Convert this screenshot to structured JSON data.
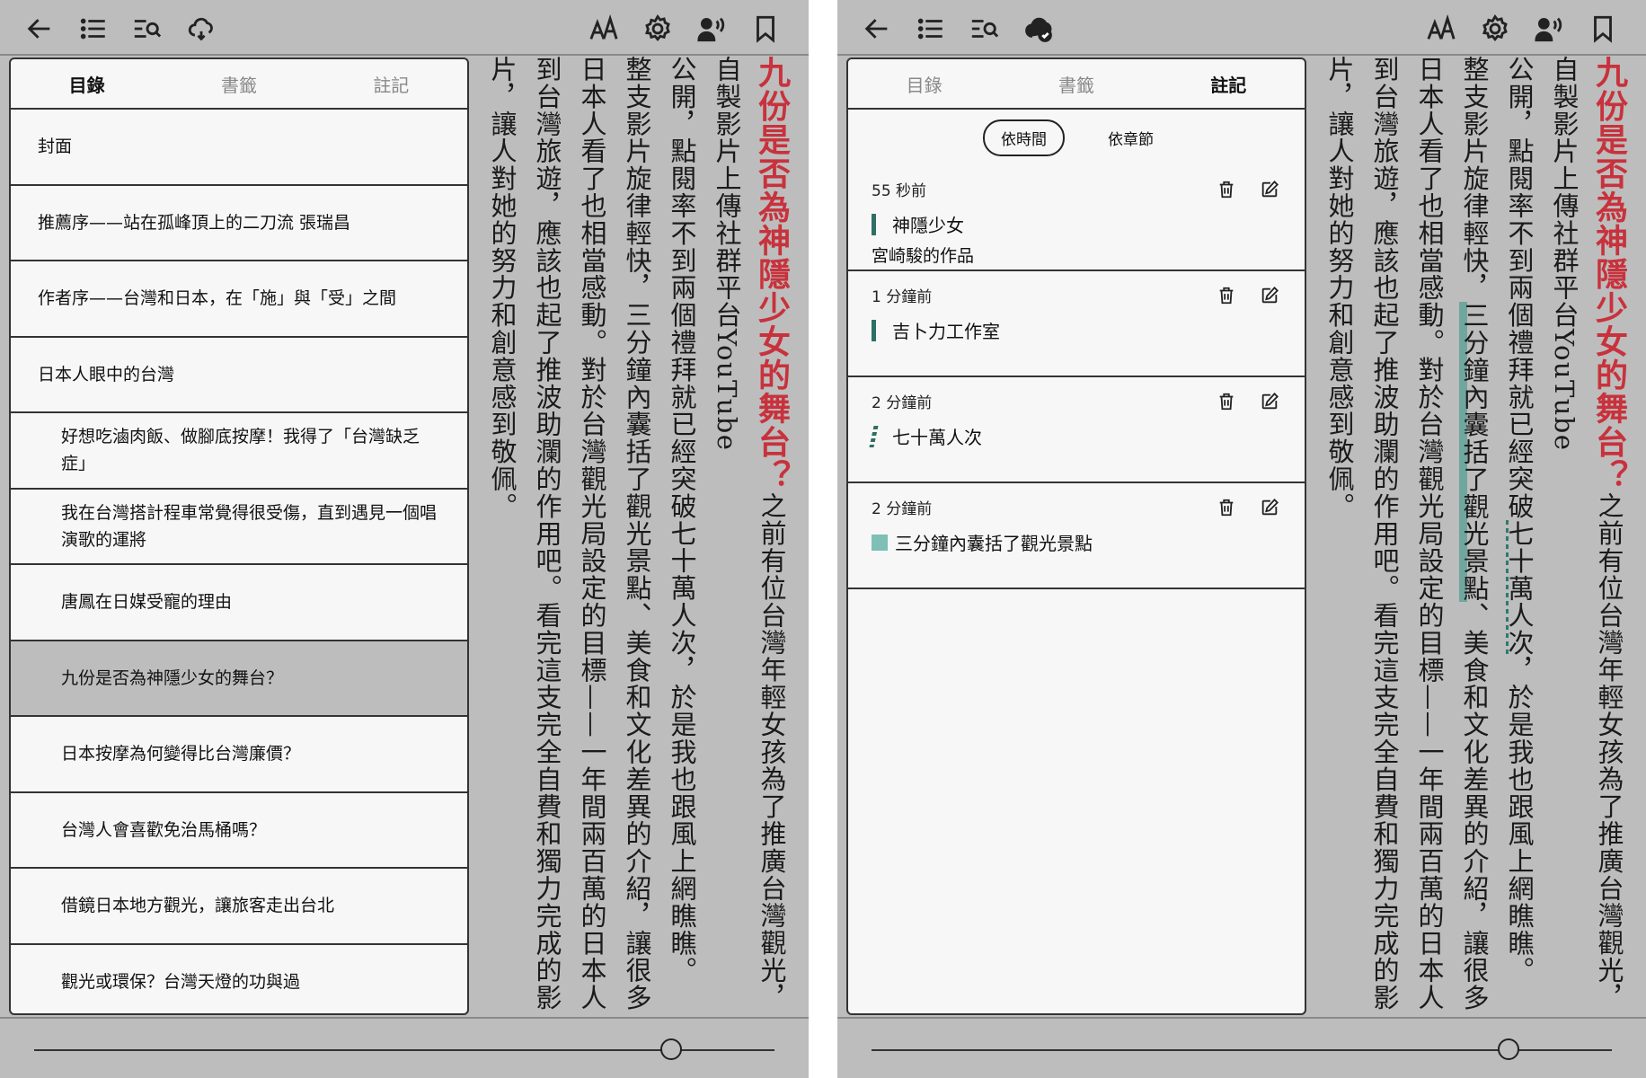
{
  "left": {
    "tabs": [
      {
        "label": "目錄",
        "active": true
      },
      {
        "label": "書籤",
        "active": false
      },
      {
        "label": "註記",
        "active": false
      }
    ],
    "toc": [
      {
        "label": "封面",
        "sub": false,
        "current": false
      },
      {
        "label": "推薦序——站在孤峰頂上的二刀流 張瑞昌",
        "sub": false,
        "current": false
      },
      {
        "label": "作者序——台灣和日本，在「施」與「受」之間",
        "sub": false,
        "current": false
      },
      {
        "label": "日本人眼中的台灣",
        "sub": false,
        "current": false
      },
      {
        "label": "好想吃滷肉飯、做腳底按摩！我得了「台灣缺乏症」",
        "sub": true,
        "current": false
      },
      {
        "label": "我在台灣搭計程車常覺得很受傷，直到遇見一個唱演歌的運將",
        "sub": true,
        "current": false
      },
      {
        "label": "唐鳳在日媒受寵的理由",
        "sub": true,
        "current": false
      },
      {
        "label": "九份是否為神隱少女的舞台？",
        "sub": true,
        "current": true
      },
      {
        "label": "日本按摩為何變得比台灣廉價？",
        "sub": true,
        "current": false
      },
      {
        "label": "台灣人會喜歡免治馬桶嗎？",
        "sub": true,
        "current": false
      },
      {
        "label": "借鏡日本地方觀光，讓旅客走出台北",
        "sub": true,
        "current": false
      },
      {
        "label": "觀光或環保？台灣天燈的功與過",
        "sub": true,
        "current": false
      }
    ],
    "slider_value": 0.86
  },
  "right": {
    "tabs": [
      {
        "label": "目錄",
        "active": false
      },
      {
        "label": "書籤",
        "active": false
      },
      {
        "label": "註記",
        "active": true
      }
    ],
    "sort": {
      "by_time": "依時間",
      "by_chapter": "依章節",
      "active": "by_time"
    },
    "notes": [
      {
        "time": "55 秒前",
        "text": "神隱少女",
        "mark": "solid",
        "comment": "宮崎駿的作品"
      },
      {
        "time": "1 分鐘前",
        "text": "吉卜力工作室",
        "mark": "solid",
        "comment": ""
      },
      {
        "time": "2 分鐘前",
        "text": "七十萬人次",
        "mark": "dash",
        "comment": ""
      },
      {
        "time": "2 分鐘前",
        "text": "三分鐘內囊括了觀光景點",
        "mark": "block",
        "comment": ""
      }
    ],
    "slider_value": 0.86
  },
  "reading": {
    "title": "九份是否為神隱少女的舞台？",
    "p1a": "之前有位台灣年輕女孩為了推廣台灣觀光，自製影片上傳社群平台YouTube",
    "p1b": "公開，點閱率不到兩個禮拜就已經突破",
    "p1c": "七十萬人次",
    "p1d": "，於是我也跟風上網瞧瞧。",
    "p2a": "整支影片旋律輕快，",
    "p2b": "三分鐘內囊括了觀光景點",
    "p2c": "、美食和文化差異的介紹，讓很多日本人看了也相當感動。對於台灣觀光局設定的目標——一年間兩百萬的日本人到台灣旅遊，應該也起了推波助瀾的作用吧。看完這支完全自費和獨力完成的影片，讓人對她的努力和創意感到敬佩。"
  },
  "colors": {
    "accent_red": "#c8323c",
    "highlight_teal": "#5ea59a",
    "screen_bg": "#bdbdbd"
  },
  "icons": {
    "back": "arrow-left-icon",
    "toc": "list-icon",
    "search": "search-text-icon",
    "sync": "cloud-sync-icon",
    "font": "font-size-icon",
    "settings": "gear-icon",
    "tts": "read-aloud-icon",
    "bookmark": "bookmark-icon",
    "delete": "trash-icon",
    "edit": "edit-icon"
  }
}
